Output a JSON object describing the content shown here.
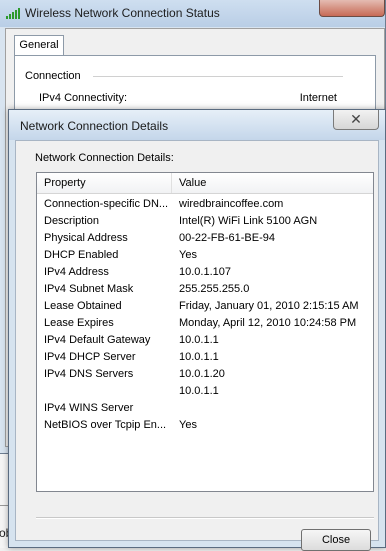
{
  "back_window": {
    "title": "Wireless Network Connection Status",
    "tab_label": "General",
    "section_label": "Connection",
    "row_label": "IPv4 Connectivity:",
    "row_value": "Internet"
  },
  "bottom_text": "ob",
  "dialog": {
    "title": "Network Connection Details",
    "details_label": "Network Connection Details:",
    "columns": {
      "property": "Property",
      "value": "Value"
    },
    "rows": [
      {
        "property": "Connection-specific DN...",
        "value": "wiredbraincoffee.com"
      },
      {
        "property": "Description",
        "value": "Intel(R) WiFi Link 5100 AGN"
      },
      {
        "property": "Physical Address",
        "value": "00-22-FB-61-BE-94"
      },
      {
        "property": "DHCP Enabled",
        "value": "Yes"
      },
      {
        "property": "IPv4 Address",
        "value": "10.0.1.107"
      },
      {
        "property": "IPv4 Subnet Mask",
        "value": "255.255.255.0"
      },
      {
        "property": "Lease Obtained",
        "value": "Friday, January 01, 2010 2:15:15 AM"
      },
      {
        "property": "Lease Expires",
        "value": "Monday, April 12, 2010 10:24:58 PM"
      },
      {
        "property": "IPv4 Default Gateway",
        "value": "10.0.1.1"
      },
      {
        "property": "IPv4 DHCP Server",
        "value": "10.0.1.1"
      },
      {
        "property": "IPv4 DNS Servers",
        "value": "10.0.1.20"
      },
      {
        "property": "",
        "value": "10.0.1.1"
      },
      {
        "property": "IPv4 WINS Server",
        "value": ""
      },
      {
        "property": "NetBIOS over Tcpip En...",
        "value": "Yes"
      }
    ],
    "close_button": "Close",
    "close_glyph": "✕"
  },
  "colors": {
    "title_bar_start": "#e6eff8",
    "title_bar_end": "#c4d6ea",
    "back_close_red": "#c76a55"
  },
  "icons": [
    "wireless-signal-icon",
    "close-icon"
  ]
}
